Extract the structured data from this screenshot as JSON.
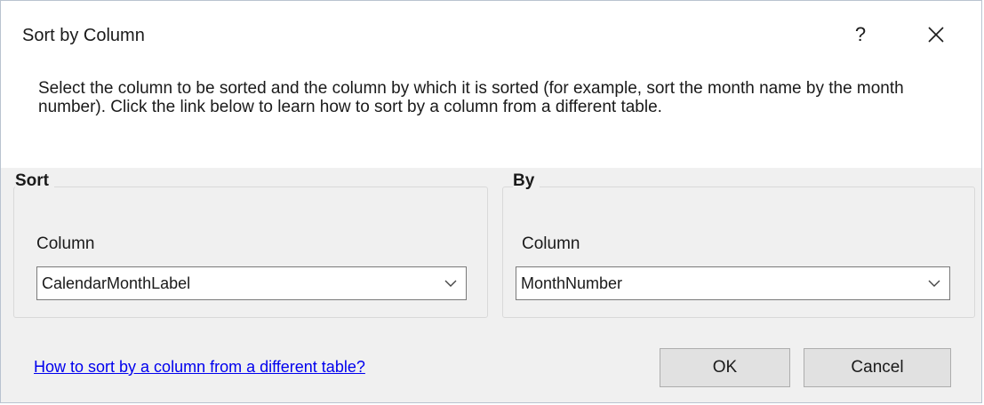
{
  "dialog": {
    "title": "Sort by Column",
    "help_label": "?",
    "close_icon": "close-icon",
    "description": "Select the column to be sorted and the column by which it is sorted (for example, sort the month name by the month number). Click the link below to learn how to sort by a column from a different table."
  },
  "sort_group": {
    "header": "Sort",
    "column_label": "Column",
    "column_value": "CalendarMonthLabel"
  },
  "by_group": {
    "header": "By",
    "column_label": "Column",
    "column_value": "MonthNumber"
  },
  "footer": {
    "help_link": "How to sort by a column from a different table?",
    "ok_label": "OK",
    "cancel_label": "Cancel"
  },
  "colors": {
    "dialog_background": "#f0f0f0",
    "content_background": "#ffffff",
    "link": "#0000ee",
    "button_face": "#e1e1e1"
  }
}
